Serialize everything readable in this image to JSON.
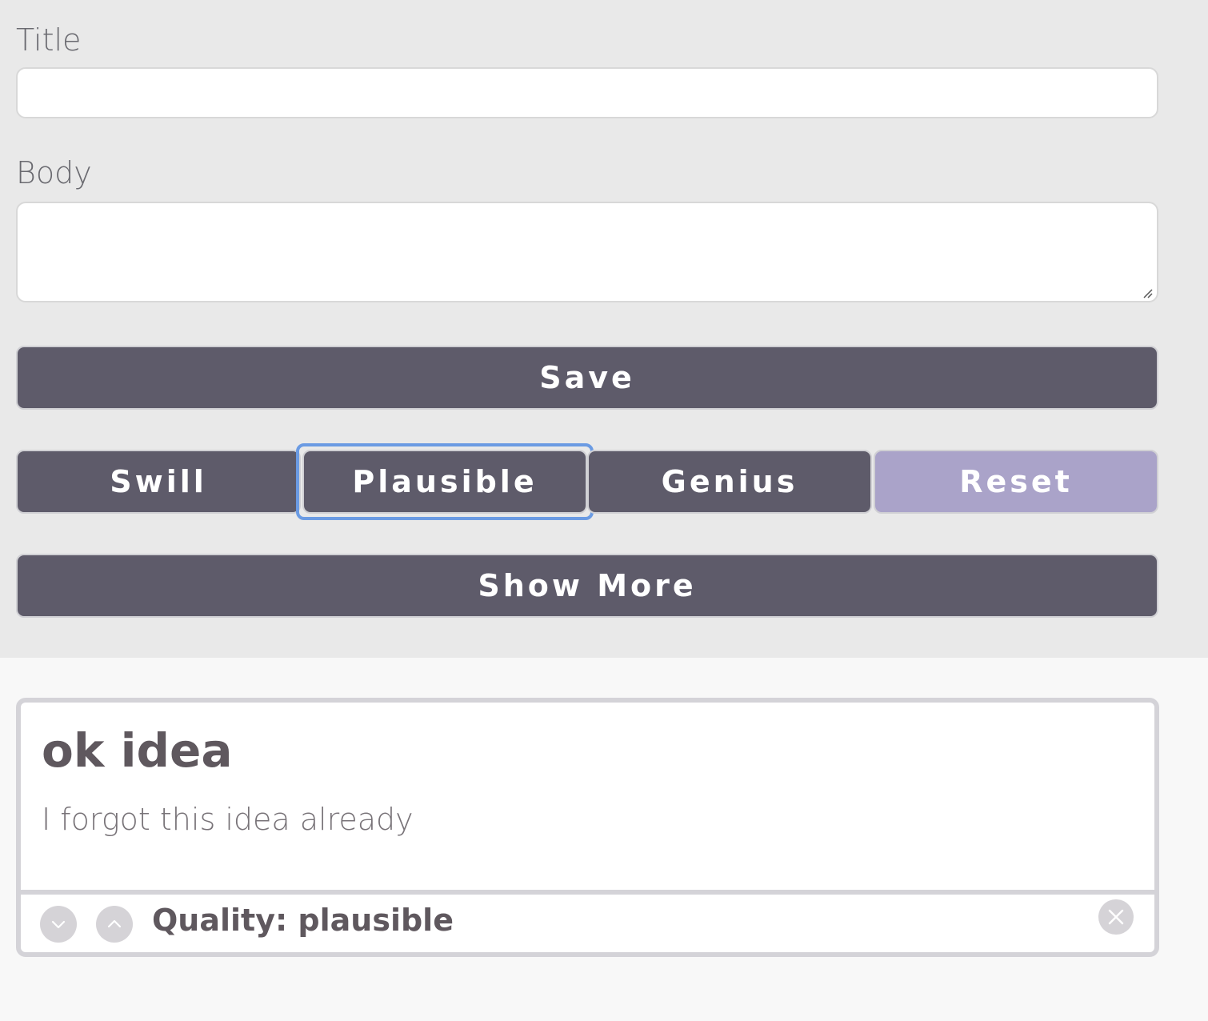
{
  "form": {
    "title_label": "Title",
    "title_value": "",
    "body_label": "Body",
    "body_value": "",
    "save_label": "Save",
    "filters": {
      "swill": "Swill",
      "plausible": "Plausible",
      "genius": "Genius",
      "reset": "Reset"
    },
    "show_more_label": "Show More"
  },
  "ideas": [
    {
      "title": "ok idea",
      "body": "I forgot this idea already",
      "quality": "Quality: plausible"
    }
  ],
  "colors": {
    "button_bg": "#5e5b6a",
    "reset_bg": "#aaa3c9",
    "focus_ring": "#6b9be3",
    "top_bg": "#e9e9e9",
    "page_bg": "#f8f8f8"
  },
  "icons": {
    "downvote": "chevron-down-icon",
    "upvote": "chevron-up-icon",
    "delete": "close-icon"
  }
}
